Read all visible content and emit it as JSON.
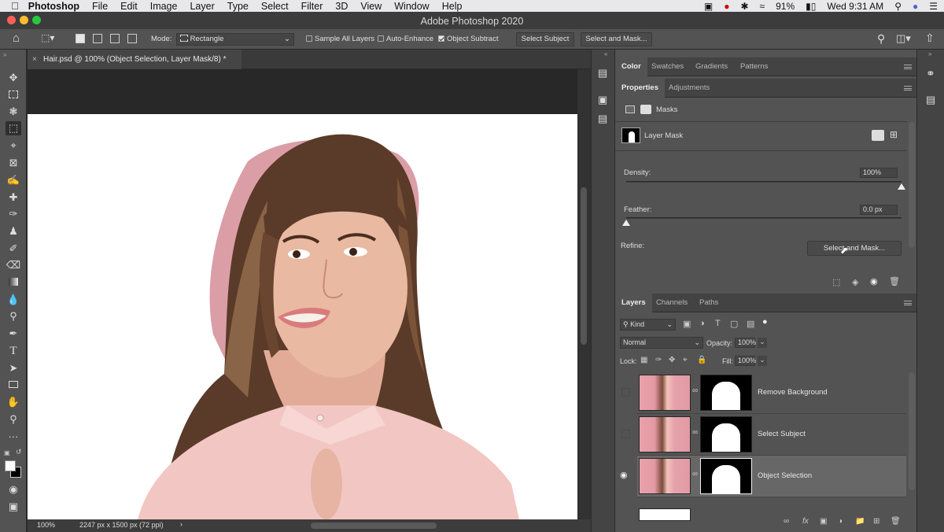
{
  "menubar": {
    "items": [
      "Photoshop",
      "File",
      "Edit",
      "Image",
      "Layer",
      "Type",
      "Select",
      "Filter",
      "3D",
      "View",
      "Window",
      "Help"
    ],
    "battery": "91%",
    "clock": "Wed 9:31 AM"
  },
  "window": {
    "title": "Adobe Photoshop 2020"
  },
  "options": {
    "mode_label": "Mode:",
    "mode_value": "Rectangle",
    "sample_all_layers": "Sample All Layers",
    "auto_enhance": "Auto-Enhance",
    "object_subtract": "Object Subtract",
    "select_subject": "Select Subject",
    "select_and_mask": "Select and Mask..."
  },
  "document": {
    "tab_title": "Hair.psd @ 100% (Object Selection, Layer Mask/8) *",
    "zoom": "100%",
    "doc_info": "2247 px x 1500 px (72 ppi)"
  },
  "panels": {
    "top_tabs": [
      "Color",
      "Swatches",
      "Gradients",
      "Patterns"
    ],
    "props_tabs": [
      "Properties",
      "Adjustments"
    ],
    "masks_label": "Masks",
    "layer_mask_label": "Layer Mask",
    "density_label": "Density:",
    "density_value": "100%",
    "density": 1.0,
    "feather_label": "Feather:",
    "feather_value": "0.0 px",
    "feather": 0.0,
    "refine_label": "Refine:",
    "refine_button": "Select and Mask..."
  },
  "layers": {
    "tabs": [
      "Layers",
      "Channels",
      "Paths"
    ],
    "filter_kind": "Kind",
    "blend_mode": "Normal",
    "opacity_label": "Opacity:",
    "opacity_value": "100%",
    "lock_label": "Lock:",
    "fill_label": "Fill:",
    "fill_value": "100%",
    "rows": [
      {
        "name": "Remove Background",
        "visible": false
      },
      {
        "name": "Select Subject",
        "visible": false
      },
      {
        "name": "Object Selection",
        "visible": true,
        "selected": true
      }
    ]
  },
  "colors": {
    "accent": "#1473e6",
    "panel": "#535353",
    "dark": "#282828"
  }
}
